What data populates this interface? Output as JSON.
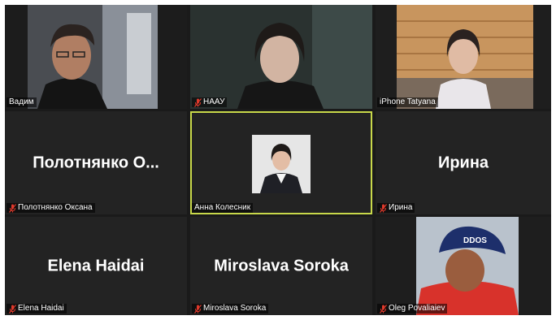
{
  "participants": [
    {
      "id": "vadim",
      "label": "Вадим",
      "muted": false,
      "display_name": ""
    },
    {
      "id": "naau",
      "label": "НААУ",
      "muted": true,
      "display_name": ""
    },
    {
      "id": "tatyana",
      "label": "iPhone Tatyana",
      "muted": false,
      "display_name": ""
    },
    {
      "id": "polotnyanko",
      "label": "Полотнянко Оксана",
      "muted": true,
      "display_name": "Полотнянко О..."
    },
    {
      "id": "kolesnik",
      "label": "Анна Колесник",
      "muted": false,
      "display_name": ""
    },
    {
      "id": "irina",
      "label": "Ирина",
      "muted": true,
      "display_name": "Ирина"
    },
    {
      "id": "haidai",
      "label": "Elena Haidai",
      "muted": true,
      "display_name": "Elena Haidai"
    },
    {
      "id": "soroka",
      "label": "Miroslava Soroka",
      "muted": true,
      "display_name": "Miroslava Soroka"
    },
    {
      "id": "povaliaiev",
      "label": "Oleg Povaliaiev",
      "muted": true,
      "display_name": ""
    }
  ],
  "cap_text": "DDOS",
  "colors": {
    "active_border": "#c8d84a",
    "muted_mic": "#e0392b",
    "tile_bg": "#232323"
  }
}
